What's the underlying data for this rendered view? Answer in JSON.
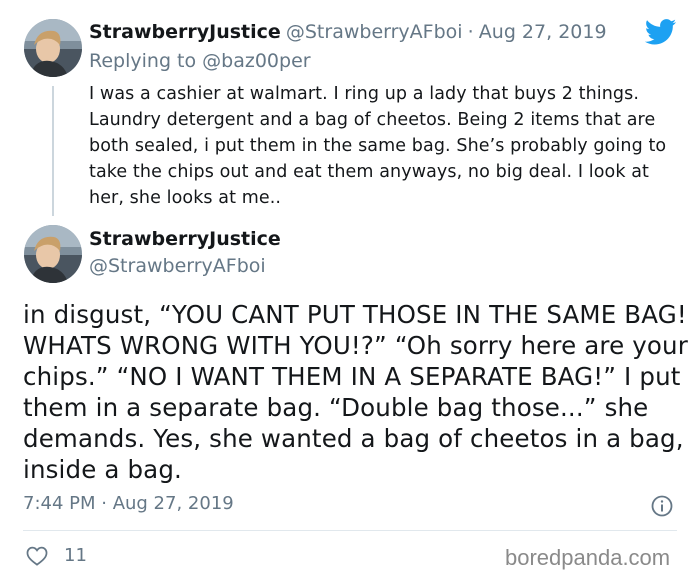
{
  "reply_tweet": {
    "display_name": "StrawberryJustice",
    "handle": "@StrawberryAFboi",
    "separator": "·",
    "date": "Aug 27, 2019",
    "replying_to": "Replying to @baz00per",
    "text": "I was a cashier at walmart. I ring up a lady that buys 2 things. Laundry detergent and a bag of cheetos. Being 2 items that are both sealed, i put them in the same bag. She’s probably going to take the chips out and eat them anyways, no big deal. I look at her, she looks at me..",
    "brand_icon": "twitter-bird-icon",
    "brand_color": "#1da1f2"
  },
  "main_tweet": {
    "display_name": "StrawberryJustice",
    "handle": "@StrawberryAFboi",
    "text": "in disgust, “YOU CANT PUT THOSE IN THE SAME BAG! WHATS WRONG WITH YOU!?” “Oh sorry here are your chips.” “NO I WANT THEM IN A SEPARATE BAG!” I put them in a separate bag. “Double bag those...” she demands. Yes, she wanted a bag of cheetos in a bag, inside a bag.",
    "timestamp": "7:44 PM · Aug 27, 2019",
    "info_icon": "info-icon",
    "like_icon": "heart-icon",
    "like_count": "11"
  },
  "watermark": "boredpanda.com"
}
